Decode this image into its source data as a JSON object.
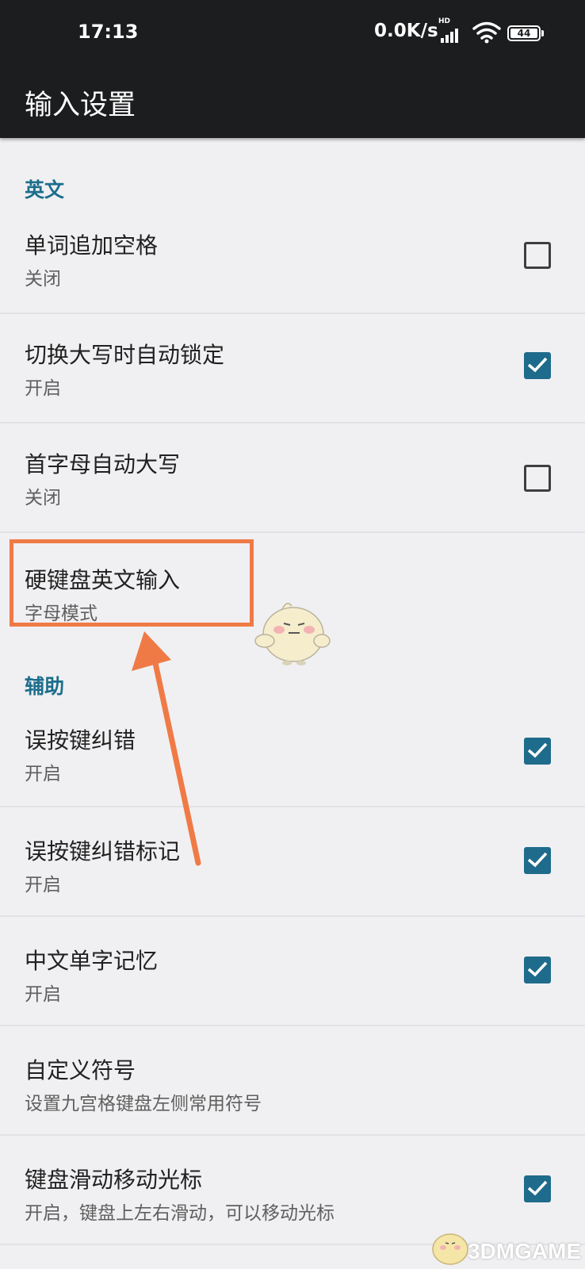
{
  "status_bar": {
    "time": "17:13",
    "network_speed": "0.0K/s",
    "hd_label": "HD",
    "battery_level": "44"
  },
  "app_bar": {
    "title": "输入设置"
  },
  "sections": {
    "english": {
      "header": "英文",
      "items": [
        {
          "title": "单词追加空格",
          "summary": "关闭",
          "checked": false
        },
        {
          "title": "切换大写时自动锁定",
          "summary": "开启",
          "checked": true
        },
        {
          "title": "首字母自动大写",
          "summary": "关闭",
          "checked": false
        },
        {
          "title": "硬键盘英文输入",
          "summary": "字母模式"
        }
      ]
    },
    "assist": {
      "header": "辅助",
      "items": [
        {
          "title": "误按键纠错",
          "summary": "开启",
          "checked": true
        },
        {
          "title": "误按键纠错标记",
          "summary": "开启",
          "checked": true
        },
        {
          "title": "中文单字记忆",
          "summary": "开启",
          "checked": true
        },
        {
          "title": "自定义符号",
          "summary": "设置九宫格键盘左侧常用符号"
        },
        {
          "title": "键盘滑动移动光标",
          "summary": "开启，键盘上左右滑动，可以移动光标",
          "checked": true
        }
      ]
    }
  },
  "annotation": {
    "highlight_color": "#f07a45"
  },
  "colors": {
    "accent": "#1f6b8b",
    "section_header": "#1c6e8c",
    "bar_bg": "#1c1d1f",
    "page_bg": "#f0f0f2"
  },
  "watermark": {
    "text": "3DMGAME"
  }
}
